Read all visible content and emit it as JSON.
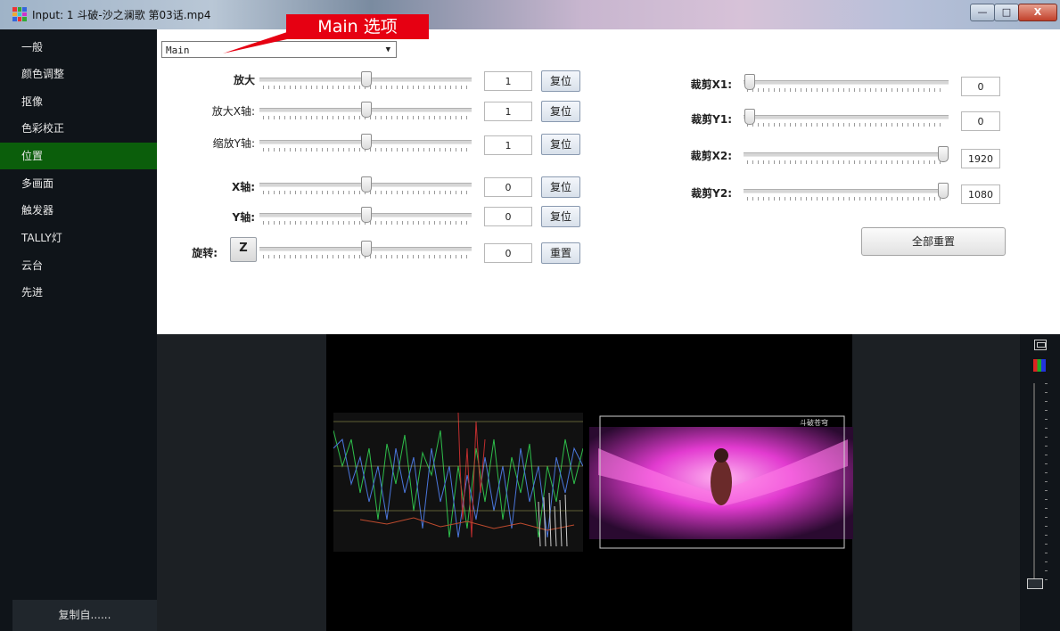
{
  "window": {
    "title": "Input: 1 斗破-沙之澜歌 第03话.mp4",
    "controls": {
      "minimize": "—",
      "maximize": "□",
      "close": "X"
    }
  },
  "callout": {
    "text": "Main 选项",
    "color": "#e60012"
  },
  "sidebar": {
    "items": [
      {
        "label": "一般"
      },
      {
        "label": "颜色调整"
      },
      {
        "label": "抠像"
      },
      {
        "label": "色彩校正"
      },
      {
        "label": "位置",
        "active": true
      },
      {
        "label": "多画面"
      },
      {
        "label": "触发器"
      },
      {
        "label": "TALLY灯"
      },
      {
        "label": "云台"
      },
      {
        "label": "先进"
      }
    ],
    "copy_from": "复制自......",
    "active_color": "#0b5e0b"
  },
  "panel": {
    "source_select": {
      "value": "Main",
      "caret": "▼"
    },
    "left_rows": [
      {
        "label": "放大",
        "value": "1",
        "button": "复位",
        "slider": 0.5
      },
      {
        "label": "放大X轴:",
        "value": "1",
        "button": "复位",
        "slider": 0.5
      },
      {
        "label": "缩放Y轴:",
        "value": "1",
        "button": "复位",
        "slider": 0.5
      },
      {
        "label": "X轴:",
        "value": "0",
        "button": "复位",
        "slider": 0.5
      },
      {
        "label": "Y轴:",
        "value": "0",
        "button": "复位",
        "slider": 0.5
      },
      {
        "label": "旋转:",
        "value": "0",
        "button": "重置",
        "slider": 0.5,
        "extra_button": "Z"
      }
    ],
    "right_rows": [
      {
        "label": "裁剪X1:",
        "value": "0",
        "slider": 0.0
      },
      {
        "label": "裁剪Y1:",
        "value": "0",
        "slider": 0.0
      },
      {
        "label": "裁剪X2:",
        "value": "1920",
        "slider": 1.0
      },
      {
        "label": "裁剪Y2:",
        "value": "1080",
        "slider": 1.0
      }
    ],
    "reset_all": "全部重置"
  },
  "preview": {
    "scene_label": "斗破苍穹",
    "icons": [
      "monitor-icon",
      "color-palette-icon"
    ]
  }
}
